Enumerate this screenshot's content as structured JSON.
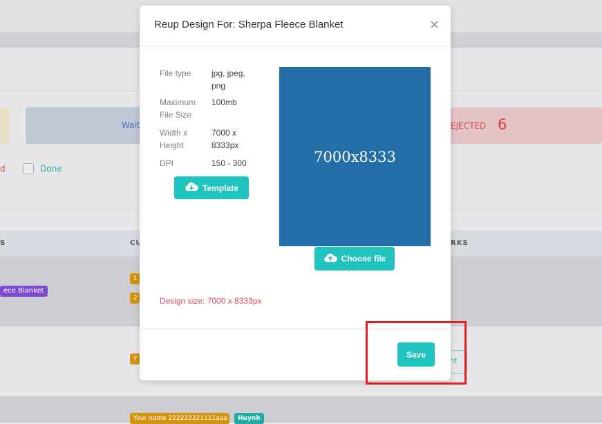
{
  "background": {
    "stats": {
      "waiting_label": "Waiti",
      "rejected_label": "EJECTED",
      "rejected_count": "6"
    },
    "filters": {
      "cut_label": "d",
      "done_label": "Done"
    },
    "table": {
      "headers": [
        "S",
        "CU",
        "RKS"
      ],
      "row1": {
        "product_tag": "ece Blanket",
        "tags": [
          "1",
          "2"
        ]
      },
      "row2": {
        "tags": [
          "Y"
        ],
        "action_label": "nt"
      },
      "row3": {
        "tags": [
          "Your name 222222221111aaa",
          "Huynh"
        ]
      }
    }
  },
  "modal": {
    "title": "Reup Design For: Sherpa Fleece Blanket",
    "close_icon": "×",
    "specs": [
      {
        "label": "File type",
        "value": "jpg, jpeg, png"
      },
      {
        "label": "Maximum File Size",
        "value": "100mb"
      },
      {
        "label": "Width x Height",
        "value": "7000 x 8333px"
      },
      {
        "label": "DPI",
        "value": "150 - 300"
      }
    ],
    "template_button": "Template",
    "preview_text": "7000x8333",
    "choose_file_button": "Choose file",
    "design_size": "Design size: 7000 x 8333px",
    "save_button": "Save"
  },
  "colors": {
    "accent": "#20c4be",
    "preview": "#236ea6",
    "error": "#e0475a",
    "highlight": "#e61e1e"
  }
}
